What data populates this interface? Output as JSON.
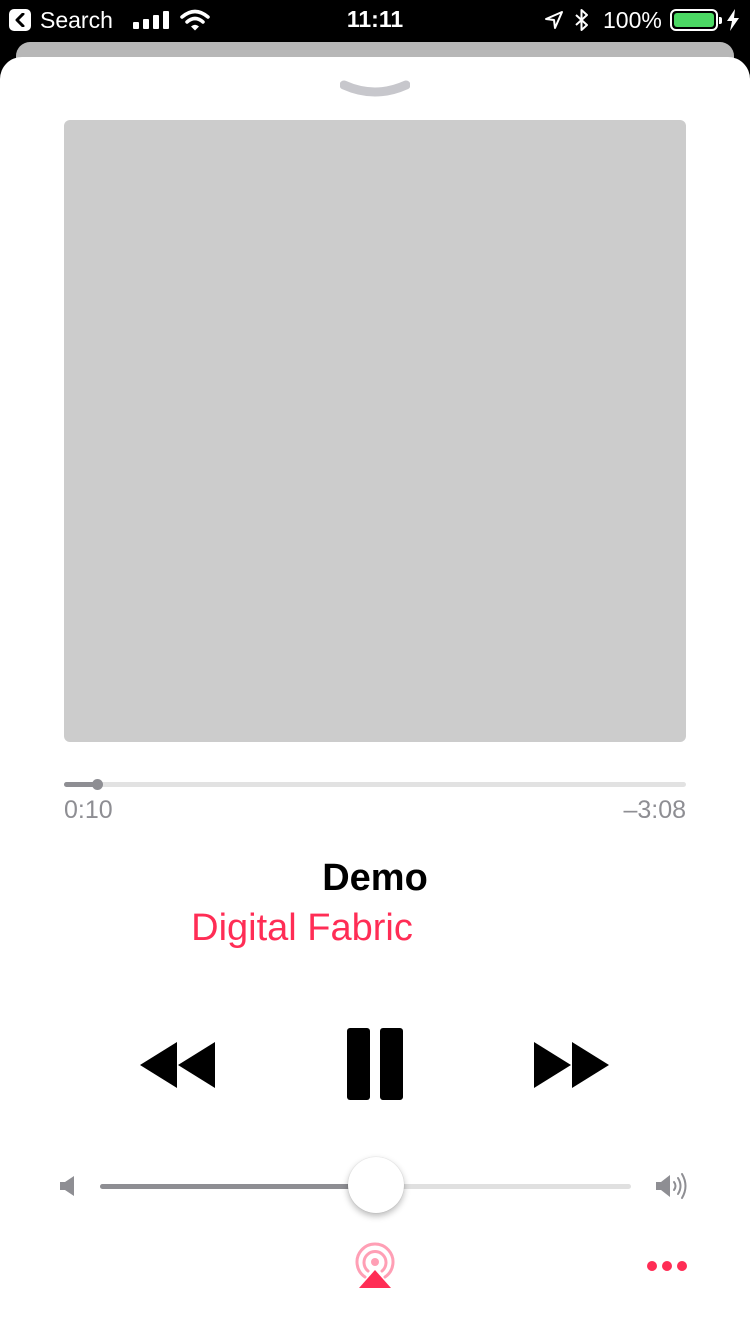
{
  "status_bar": {
    "back_label": "Search",
    "time": "11:11",
    "battery_percent_text": "100%",
    "battery_level": 1.0,
    "battery_color": "#4cd964"
  },
  "player": {
    "elapsed_time": "0:10",
    "remaining_time": "–3:08",
    "progress_fraction": 0.053,
    "title": "Demo",
    "artist": "Digital Fabric",
    "volume_fraction": 0.52,
    "accent_color": "#ff2d55",
    "icons": {
      "grabber": "chevron-down-icon",
      "rewind": "rewind-icon",
      "pause": "pause-icon",
      "forward": "fast-forward-icon",
      "volume_min": "speaker-low-icon",
      "volume_max": "speaker-high-icon",
      "airplay": "airplay-icon",
      "more": "more-icon"
    }
  }
}
